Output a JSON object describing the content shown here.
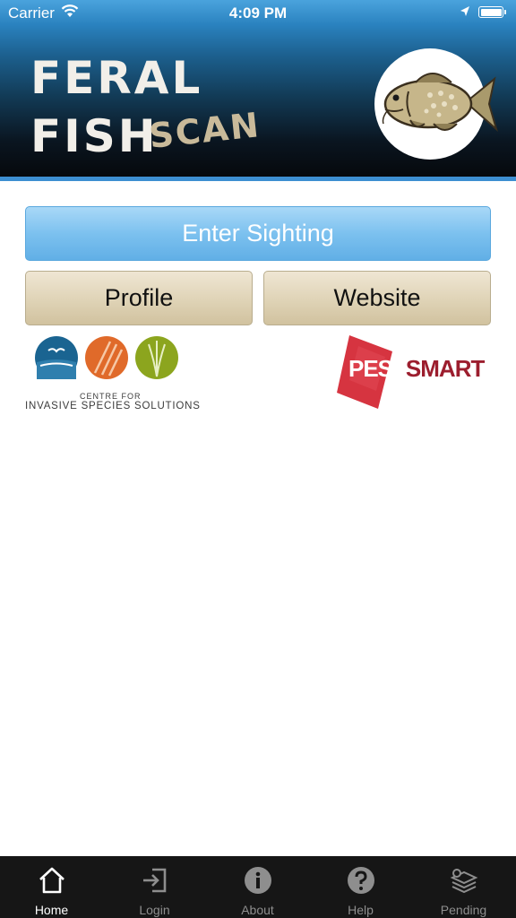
{
  "status_bar": {
    "carrier": "Carrier",
    "time": "4:09 PM"
  },
  "header": {
    "logo_lines": [
      "FERAL",
      "FISH",
      "SCAN"
    ],
    "colors": {
      "logo": "#f2efe9",
      "logo_accent": "#c9ba9a",
      "header_line": "#3d8fd1"
    }
  },
  "buttons": {
    "enter_sighting": "Enter Sighting",
    "profile": "Profile",
    "website": "Website"
  },
  "partners": {
    "cis": {
      "line1": "CENTRE FOR",
      "line2": "INVASIVE SPECIES SOLUTIONS"
    },
    "pestsmart": {
      "part1": "PEST",
      "part2": "SMART"
    }
  },
  "tabs": [
    {
      "label": "Home",
      "icon": "home-icon",
      "active": true
    },
    {
      "label": "Login",
      "icon": "login-icon",
      "active": false
    },
    {
      "label": "About",
      "icon": "info-icon",
      "active": false
    },
    {
      "label": "Help",
      "icon": "help-icon",
      "active": false
    },
    {
      "label": "Pending",
      "icon": "pending-icon",
      "active": false
    }
  ]
}
